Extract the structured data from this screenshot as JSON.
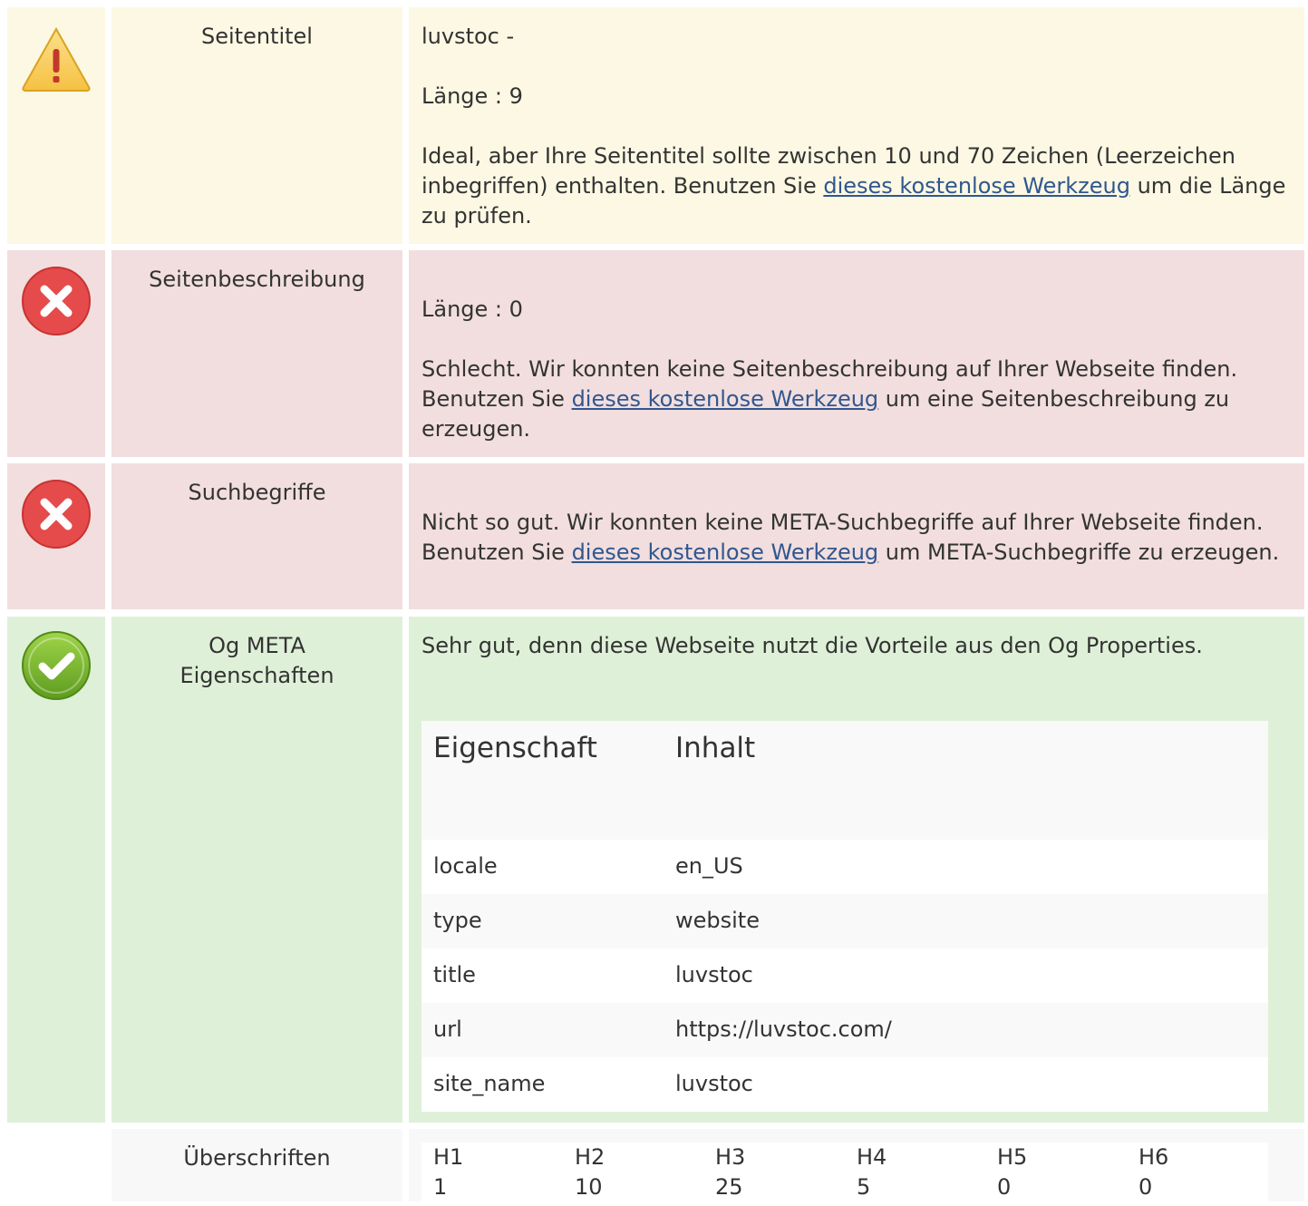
{
  "colors": {
    "warning_bg": "#fcf8e3",
    "error_bg": "#f2dede",
    "success_bg": "#dff0d8",
    "neutral_bg": "#f8f8f8",
    "link": "#30578f"
  },
  "rows": {
    "title": {
      "status_icon": "warning-icon",
      "label": "Seitentitel",
      "value": "luvstoc -",
      "length": "Länge : 9",
      "text_before": "Ideal, aber Ihre Seitentitel sollte zwischen 10 und 70 Zeichen (Leerzeichen inbegriffen) enthalten. Benutzen Sie ",
      "link": "dieses kostenlose Werkzeug",
      "text_after": " um die Länge zu prüfen."
    },
    "description": {
      "status_icon": "error-icon",
      "label": "Seitenbeschreibung",
      "length": "Länge : 0",
      "text_before": "Schlecht. Wir konnten keine Seitenbeschreibung auf Ihrer Webseite finden. Benutzen Sie ",
      "link": "dieses kostenlose Werkzeug",
      "text_after": " um eine Seitenbeschreibung zu erzeugen."
    },
    "keywords": {
      "status_icon": "error-icon",
      "label": "Suchbegriffe",
      "text_before": "Nicht so gut. Wir konnten keine META-Suchbegriffe auf Ihrer Webseite finden. Benutzen Sie ",
      "link": "dieses kostenlose Werkzeug",
      "text_after": " um META-Suchbegriffe zu erzeugen."
    },
    "og": {
      "status_icon": "success-icon",
      "label": "Og META Eigenschaften",
      "text": "Sehr gut, denn diese Webseite nutzt die Vorteile aus den Og Properties.",
      "table": {
        "col_property": "Eigenschaft",
        "col_content": "Inhalt",
        "rows": [
          {
            "property": "locale",
            "content": "en_US"
          },
          {
            "property": "type",
            "content": "website"
          },
          {
            "property": "title",
            "content": "luvstoc"
          },
          {
            "property": "url",
            "content": "https://luvstoc.com/"
          },
          {
            "property": "site_name",
            "content": "luvstoc"
          }
        ]
      }
    },
    "headings": {
      "label": "Überschriften",
      "columns": [
        {
          "tag": "H1",
          "count": "1"
        },
        {
          "tag": "H2",
          "count": "10"
        },
        {
          "tag": "H3",
          "count": "25"
        },
        {
          "tag": "H4",
          "count": "5"
        },
        {
          "tag": "H5",
          "count": "0"
        },
        {
          "tag": "H6",
          "count": "0"
        }
      ]
    }
  }
}
